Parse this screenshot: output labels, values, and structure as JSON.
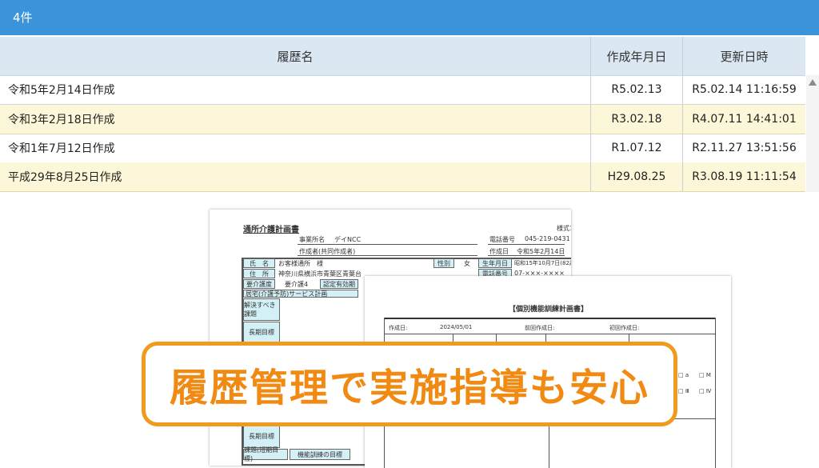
{
  "header": {
    "count_label": "4件"
  },
  "table": {
    "columns": [
      "履歴名",
      "作成年月日",
      "更新日時"
    ],
    "rows": [
      {
        "name": "令和5年2月14日作成",
        "created": "R5.02.13",
        "updated": "R5.02.14 11:16:59"
      },
      {
        "name": "令和3年2月18日作成",
        "created": "R3.02.18",
        "updated": "R4.07.11 14:41:01"
      },
      {
        "name": "令和1年7月12日作成",
        "created": "R1.07.12",
        "updated": "R2.11.27 13:51:56"
      },
      {
        "name": "平成29年8月25日作成",
        "created": "H29.08.25",
        "updated": "R3.08.19 11:11:54"
      }
    ]
  },
  "doc1": {
    "title": "通所介護計画書",
    "form_no": "様式1",
    "office_label": "事業所名",
    "office_value": "デイNCC",
    "phone_label": "電話番号",
    "phone_value": "045-219-0431",
    "author_label": "作成者(共同作成者)",
    "date_label": "作成日",
    "date_value": "令和5年2月14日",
    "name_label": "氏　名",
    "name_value": "お客様通所　様",
    "gender_label": "性別",
    "gender_value": "女",
    "birth_label": "生年月日",
    "birth_value": "昭和15年10月7日(82歳)",
    "address_label": "住　所",
    "address_value": "神奈川県横浜市青葉区青葉台",
    "tel_label": "電話番号",
    "tel_value": "07-×××-××××",
    "care_label": "要介護度",
    "care_value": "要介護4",
    "cert_label": "認定有効期",
    "plan_label": "居宅(介護予防)サービス計画",
    "issue_label": "解決すべき課題",
    "long_goal_label": "長期目標",
    "long_goal_label2": "長期目標",
    "short_issue_label": "課題(短期目標)",
    "training_label": "機能訓練の目標"
  },
  "doc2": {
    "title": "【個別機能訓練計画書】",
    "date_label": "作成日:",
    "date_value": "2024/05/01",
    "first_label": "前回作成日:",
    "initial_label": "初回作成日:",
    "check_a": "□ a",
    "check_b": "□ Ⅲ",
    "check_c": "□ Ⅳ",
    "check_d": "□ M"
  },
  "banner": {
    "text": "履歴管理で実施指導も安心"
  },
  "colors": {
    "topbar": "#3b94d9",
    "header_bg": "#dbe8f4",
    "alt_row": "#fdf7d9",
    "banner_border": "#f09a1e",
    "banner_text": "#f08a12"
  }
}
